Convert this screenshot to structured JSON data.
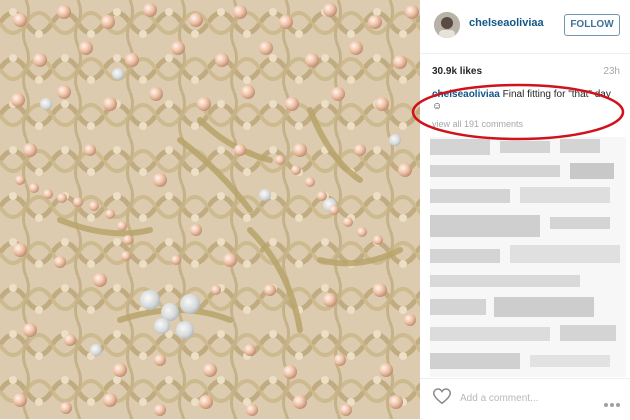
{
  "post": {
    "username": "chelseaoliviaa",
    "follow_label": "FOLLOW",
    "likes": "30.9k likes",
    "time_ago": "23h",
    "caption_username": "chelseaoliviaa",
    "caption_text": "Final fitting for \"that\" day",
    "caption_emoji": "☺",
    "view_all_comments": "view all 191 comments",
    "add_comment_placeholder": "Add a comment...",
    "more_icon": "•••"
  },
  "icons": {
    "heart": "heart-icon",
    "more": "more-options-icon"
  },
  "colors": {
    "username_blue": "#125688",
    "follow_blue": "#3f729b",
    "highlight_red": "#d0121b",
    "muted_gray": "#a5a7aa"
  }
}
